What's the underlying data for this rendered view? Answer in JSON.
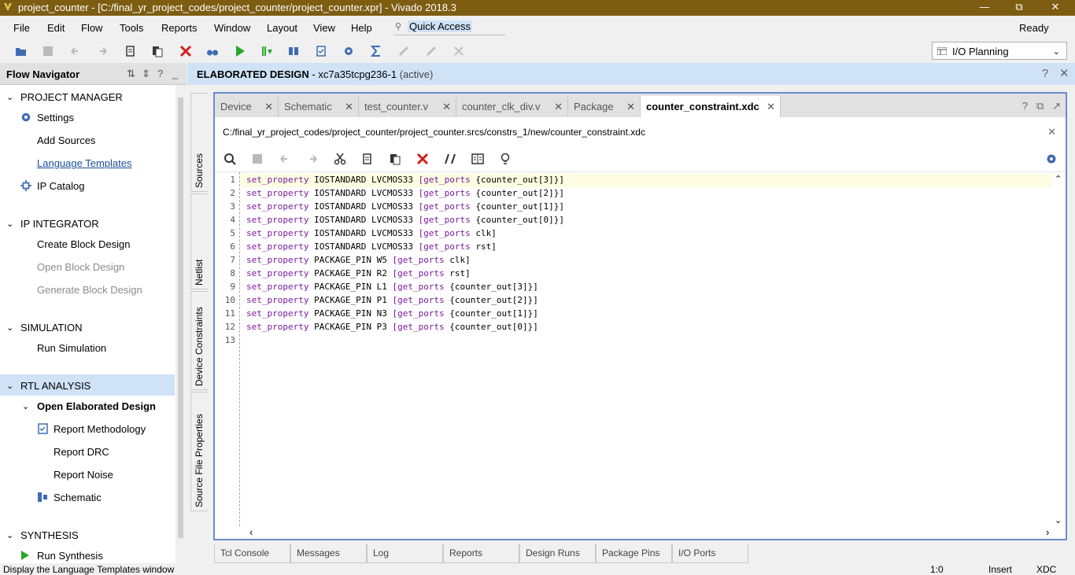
{
  "window": {
    "title": "project_counter - [C:/final_yr_project_codes/project_counter/project_counter.xpr] - Vivado 2018.3",
    "minimize": "—",
    "restore": "⧉",
    "close": "✕"
  },
  "menu": [
    "File",
    "Edit",
    "Flow",
    "Tools",
    "Reports",
    "Window",
    "Layout",
    "View",
    "Help"
  ],
  "quick_access": "Quick Access",
  "status_ready": "Ready",
  "layout_select": "I/O Planning",
  "flow_navigator": {
    "title": "Flow Navigator",
    "project_manager": "PROJECT MANAGER",
    "settings": "Settings",
    "add_sources": "Add Sources",
    "language_templates": "Language Templates",
    "ip_catalog": "IP Catalog",
    "ip_integrator": "IP INTEGRATOR",
    "create_block_design": "Create Block Design",
    "open_block_design": "Open Block Design",
    "generate_block_design": "Generate Block Design",
    "simulation": "SIMULATION",
    "run_simulation": "Run Simulation",
    "rtl_analysis": "RTL ANALYSIS",
    "open_elaborated_design": "Open Elaborated Design",
    "report_methodology": "Report Methodology",
    "report_drc": "Report DRC",
    "report_noise": "Report Noise",
    "schematic": "Schematic",
    "synthesis": "SYNTHESIS",
    "run_synthesis": "Run Synthesis"
  },
  "editor_header": {
    "title": "ELABORATED DESIGN",
    "part": " - xc7a35tcpg236-1",
    "state": "(active)"
  },
  "side_tabs": [
    "Sources",
    "Netlist",
    "Device Constraints",
    "Source File Properties"
  ],
  "tabs": [
    "Device",
    "Schematic",
    "test_counter.v",
    "counter_clk_div.v",
    "Package",
    "counter_constraint.xdc"
  ],
  "file_path": "C:/final_yr_project_codes/project_counter/project_counter.srcs/constrs_1/new/counter_constraint.xdc",
  "code_lines": [
    {
      "n": "1",
      "kw1": "set_property",
      "mid": " IOSTANDARD LVCMOS33 ",
      "kw2": "[get_ports",
      "rest": " {counter_out[3]}]"
    },
    {
      "n": "2",
      "kw1": "set_property",
      "mid": " IOSTANDARD LVCMOS33 ",
      "kw2": "[get_ports",
      "rest": " {counter_out[2]}]"
    },
    {
      "n": "3",
      "kw1": "set_property",
      "mid": " IOSTANDARD LVCMOS33 ",
      "kw2": "[get_ports",
      "rest": " {counter_out[1]}]"
    },
    {
      "n": "4",
      "kw1": "set_property",
      "mid": " IOSTANDARD LVCMOS33 ",
      "kw2": "[get_ports",
      "rest": " {counter_out[0]}]"
    },
    {
      "n": "5",
      "kw1": "set_property",
      "mid": " IOSTANDARD LVCMOS33 ",
      "kw2": "[get_ports",
      "rest": " clk]"
    },
    {
      "n": "6",
      "kw1": "set_property",
      "mid": " IOSTANDARD LVCMOS33 ",
      "kw2": "[get_ports",
      "rest": " rst]"
    },
    {
      "n": "7",
      "kw1": "set_property",
      "mid": " PACKAGE_PIN W5 ",
      "kw2": "[get_ports",
      "rest": " clk]"
    },
    {
      "n": "8",
      "kw1": "set_property",
      "mid": " PACKAGE_PIN R2 ",
      "kw2": "[get_ports",
      "rest": " rst]"
    },
    {
      "n": "9",
      "kw1": "set_property",
      "mid": " PACKAGE_PIN L1 ",
      "kw2": "[get_ports",
      "rest": " {counter_out[3]}]"
    },
    {
      "n": "10",
      "kw1": "set_property",
      "mid": " PACKAGE_PIN P1 ",
      "kw2": "[get_ports",
      "rest": " {counter_out[2]}]"
    },
    {
      "n": "11",
      "kw1": "set_property",
      "mid": " PACKAGE_PIN N3 ",
      "kw2": "[get_ports",
      "rest": " {counter_out[1]}]"
    },
    {
      "n": "12",
      "kw1": "set_property",
      "mid": " PACKAGE_PIN P3 ",
      "kw2": "[get_ports",
      "rest": " {counter_out[0]}]"
    },
    {
      "n": "13",
      "kw1": "",
      "mid": "",
      "kw2": "",
      "rest": ""
    }
  ],
  "bottom_tabs": [
    "Tcl Console",
    "Messages",
    "Log",
    "Reports",
    "Design Runs",
    "Package Pins",
    "I/O Ports"
  ],
  "statusbar": {
    "message": "Display the Language Templates window",
    "position": "1:0",
    "mode": "Insert",
    "filetype": "XDC"
  },
  "colors": {
    "titlebar": "#7d5d12",
    "accent": "#cfe2f6",
    "keyword": "#7a1a9d",
    "editor_border": "#6a8ccc"
  }
}
